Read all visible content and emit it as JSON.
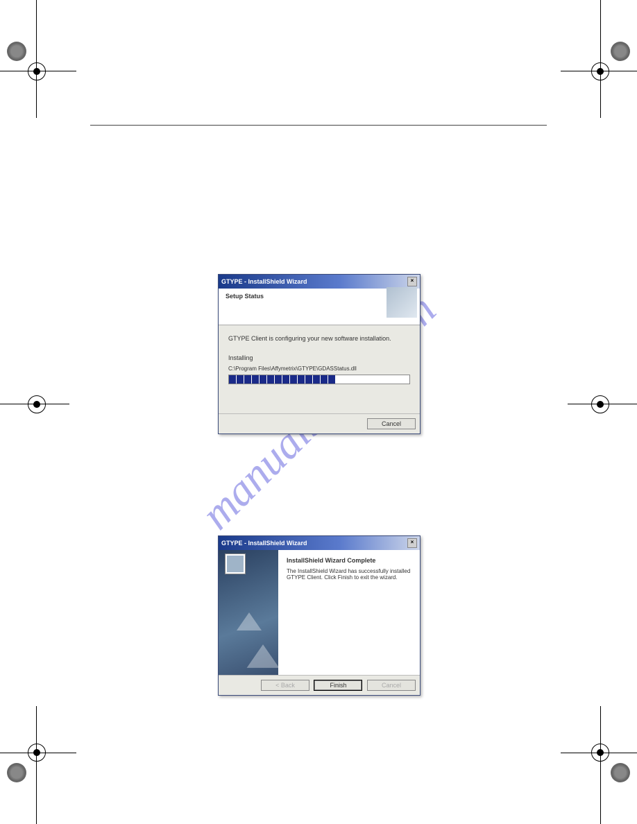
{
  "watermark": "manualshive.com",
  "dialog1": {
    "title": "GTYPE - InstallShield Wizard",
    "header": "Setup Status",
    "status_line": "GTYPE Client is configuring your new software installation.",
    "stage_label": "Installing",
    "path": "C:\\Program Files\\Affymetrix\\GTYPE\\GDASStatus.dll",
    "cancel": "Cancel"
  },
  "dialog2": {
    "title": "GTYPE - InstallShield Wizard",
    "header": "InstallShield Wizard Complete",
    "body": "The InstallShield Wizard has successfully installed GTYPE Client. Click Finish to exit the wizard.",
    "back": "< Back",
    "finish": "Finish",
    "cancel": "Cancel"
  }
}
